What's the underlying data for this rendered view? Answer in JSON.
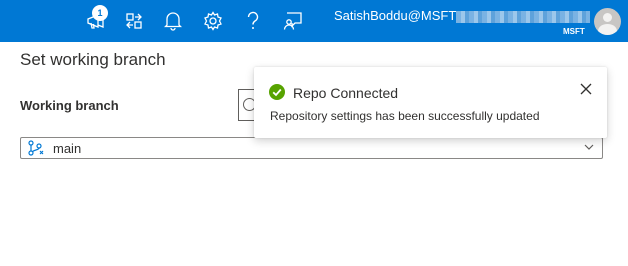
{
  "header": {
    "notification_count": "1",
    "user_name": "SatishBoddu@MSFT",
    "org": "MSFT"
  },
  "colors": {
    "brand": "#0078d4",
    "success": "#57a300"
  },
  "icons": [
    "feedback-icon",
    "settings-switch-icon",
    "bell-icon",
    "gear-icon",
    "help-icon",
    "person-feedback-icon"
  ],
  "panel": {
    "title": "Set working branch",
    "working_branch_label": "Working branch",
    "branch_value": "main"
  },
  "toast": {
    "title": "Repo Connected",
    "message": "Repository settings has been successfully updated"
  }
}
